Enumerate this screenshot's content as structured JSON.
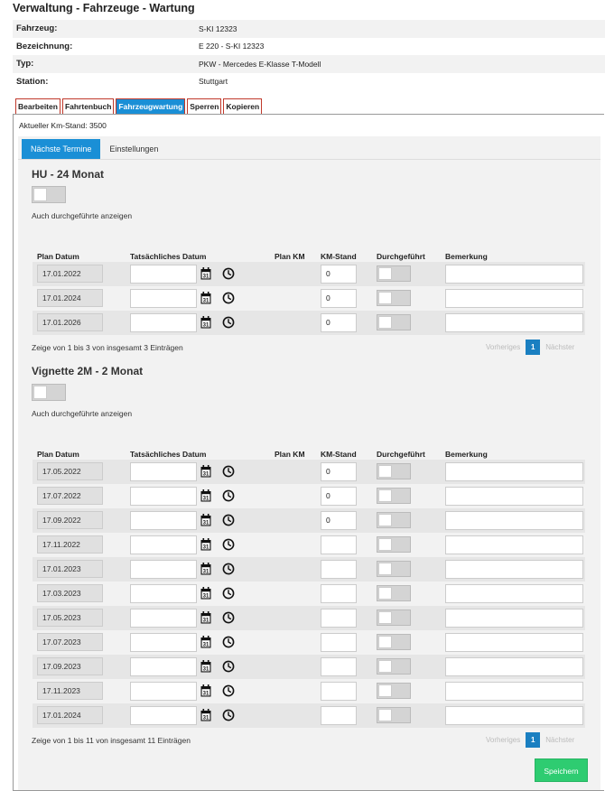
{
  "page": {
    "title": "Verwaltung - Fahrzeuge - Wartung"
  },
  "info": [
    {
      "label": "Fahrzeug:",
      "value": "S-KI 12323"
    },
    {
      "label": "Bezeichnung:",
      "value": "E 220 - S-KI 12323"
    },
    {
      "label": "Typ:",
      "value": "PKW - Mercedes E-Klasse T-Modell"
    },
    {
      "label": "Station:",
      "value": "Stuttgart"
    }
  ],
  "tabs": [
    "Bearbeiten",
    "Fahrtenbuch",
    "Fahrzeugwartung",
    "Sperren",
    "Kopieren"
  ],
  "km_stand": "Aktueller Km-Stand: 3500",
  "subtabs": [
    "Nächste Termine",
    "Einstellungen"
  ],
  "columns": [
    "Plan Datum",
    "Tatsächliches Datum",
    "Plan KM",
    "KM-Stand",
    "Durchgeführt",
    "Bemerkung"
  ],
  "toggle_label": "Auch durchgeführte anzeigen",
  "section1": {
    "title": "HU - 24 Monat",
    "rows": [
      {
        "plan": "17.01.2022",
        "km": "0"
      },
      {
        "plan": "17.01.2024",
        "km": "0"
      },
      {
        "plan": "17.01.2026",
        "km": "0"
      }
    ],
    "footer": "Zeige von 1 bis 3 von insgesamt 3 Einträgen"
  },
  "section2": {
    "title": "Vignette 2M - 2 Monat",
    "rows": [
      {
        "plan": "17.05.2022",
        "km": "0"
      },
      {
        "plan": "17.07.2022",
        "km": "0"
      },
      {
        "plan": "17.09.2022",
        "km": "0"
      },
      {
        "plan": "17.11.2022",
        "km": ""
      },
      {
        "plan": "17.01.2023",
        "km": ""
      },
      {
        "plan": "17.03.2023",
        "km": ""
      },
      {
        "plan": "17.05.2023",
        "km": ""
      },
      {
        "plan": "17.07.2023",
        "km": ""
      },
      {
        "plan": "17.09.2023",
        "km": ""
      },
      {
        "plan": "17.11.2023",
        "km": ""
      },
      {
        "plan": "17.01.2024",
        "km": ""
      }
    ],
    "footer": "Zeige von 1 bis 11 von insgesamt 11 Einträgen"
  },
  "pager": {
    "prev": "Vorheriges",
    "page": "1",
    "next": "Nächster"
  },
  "save_label": "Speichern",
  "icons": {
    "calendar": "calendar-icon",
    "clock": "clock-icon"
  }
}
